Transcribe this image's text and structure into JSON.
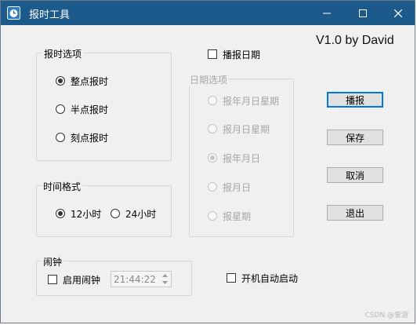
{
  "window": {
    "title": "报时工具",
    "version": "V1.0 by David"
  },
  "report_options": {
    "legend": "报时选项",
    "items": [
      {
        "label": "整点报时",
        "selected": true
      },
      {
        "label": "半点报时",
        "selected": false
      },
      {
        "label": "刻点报时",
        "selected": false
      }
    ]
  },
  "announce_date": {
    "label": "播报日期",
    "checked": false
  },
  "date_options": {
    "legend": "日期选项",
    "enabled": false,
    "items": [
      {
        "label": "报年月日星期",
        "selected": false
      },
      {
        "label": "报月日星期",
        "selected": false
      },
      {
        "label": "报年月日",
        "selected": true
      },
      {
        "label": "报月日",
        "selected": false
      },
      {
        "label": "报星期",
        "selected": false
      }
    ]
  },
  "time_format": {
    "legend": "时间格式",
    "items": [
      {
        "label": "12小时",
        "selected": true
      },
      {
        "label": "24小时",
        "selected": false
      }
    ]
  },
  "alarm": {
    "legend": "闹钟",
    "enable_label": "启用闹钟",
    "enabled": false,
    "time": "21:44:22"
  },
  "autostart": {
    "label": "开机自动启动",
    "checked": false
  },
  "buttons": {
    "broadcast": "播报",
    "save": "保存",
    "cancel": "取消",
    "exit": "退出"
  },
  "watermark": "CSDN @爱游",
  "colors": {
    "titlebar": "#1c5a8c",
    "focus_border": "#0078d7",
    "window_bg": "#f0f0f0"
  }
}
